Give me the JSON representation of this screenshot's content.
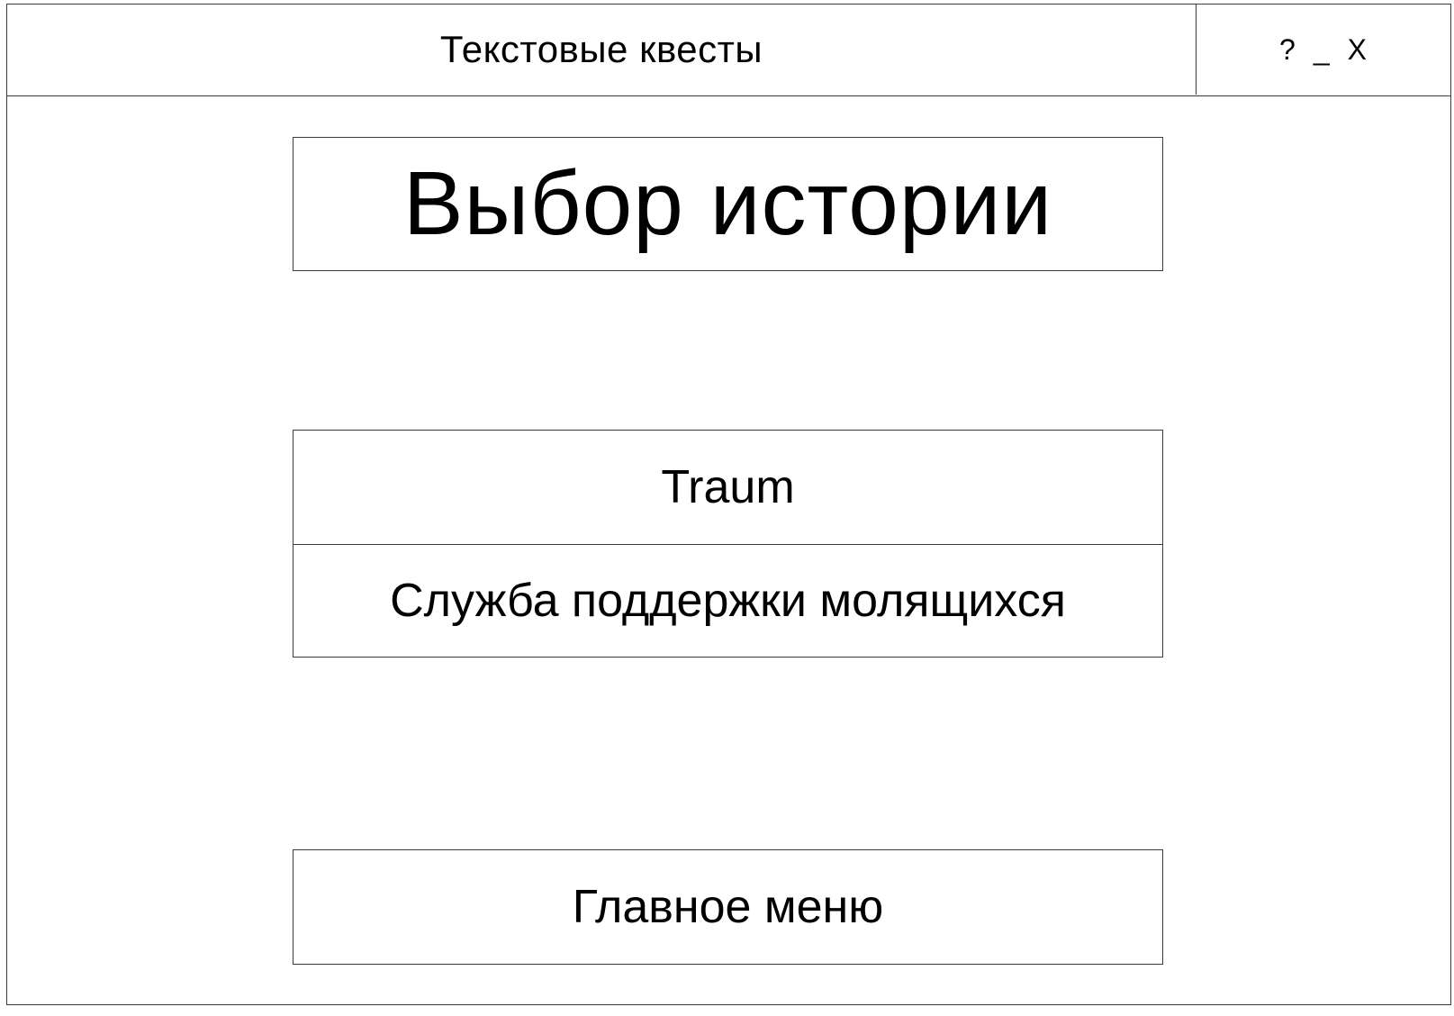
{
  "window": {
    "title": "Текстовые квесты",
    "controls": {
      "help": "?",
      "minimize": "_",
      "close": "X"
    }
  },
  "main": {
    "heading": "Выбор истории",
    "stories": [
      {
        "label": "Traum"
      },
      {
        "label": "Служба поддержки молящихся"
      }
    ],
    "main_menu_label": "Главное меню"
  }
}
